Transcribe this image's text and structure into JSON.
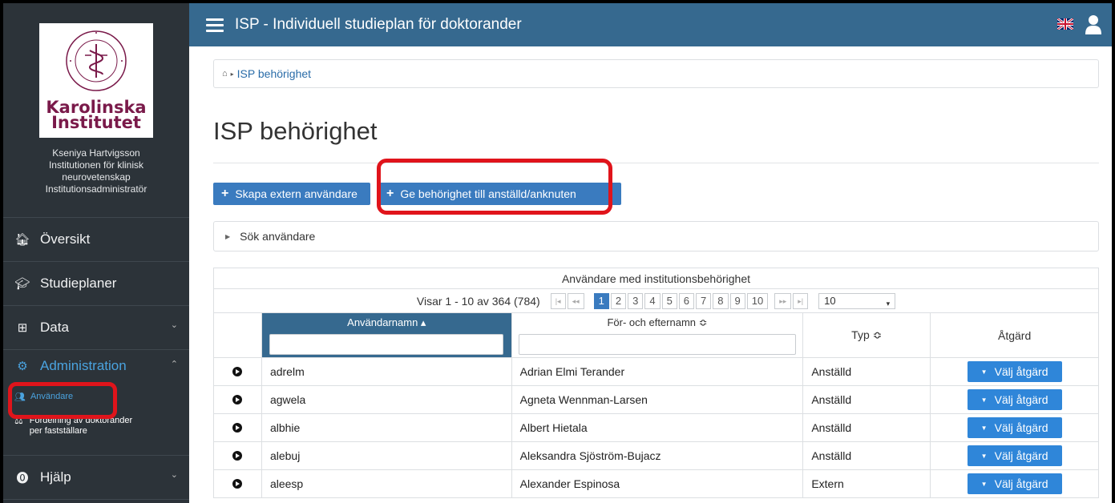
{
  "app": {
    "title": "ISP - Individuell studieplan för doktorander"
  },
  "profile": {
    "logo_line1": "Karolinska",
    "logo_line2": "Institutet",
    "name": "Kseniya Hartvigsson",
    "dept1": "Institutionen för klinisk",
    "dept2": "neurovetenskap",
    "role": "Institutionsadministratör"
  },
  "nav": {
    "oversikt": "Översikt",
    "studieplaner": "Studieplaner",
    "data": "Data",
    "administration": "Administration",
    "anvandare": "Användare",
    "fordelning1": "Fördelning av doktorander",
    "fordelning2": "per fastställare",
    "hjalp": "Hjälp"
  },
  "breadcrumb": {
    "current": "ISP behörighet"
  },
  "page": {
    "title": "ISP behörighet",
    "btn_create": "Skapa extern användare",
    "btn_grant": "Ge behörighet till anställd/anknuten",
    "search_label": "Sök användare"
  },
  "table": {
    "caption": "Användare med institutionsbehörighet",
    "pager_info": "Visar 1 - 10 av 364  (784)",
    "pages": [
      "1",
      "2",
      "3",
      "4",
      "5",
      "6",
      "7",
      "8",
      "9",
      "10"
    ],
    "page_size": "10",
    "headers": {
      "username": "Användarnamn ▴",
      "fullname": "För- och efternamn ≎",
      "type": "Typ ≎",
      "action": "Åtgärd"
    },
    "action_label": "Välj åtgärd",
    "rows": [
      {
        "username": "adrelm",
        "fullname": "Adrian Elmi Terander",
        "type": "Anställd"
      },
      {
        "username": "agwela",
        "fullname": "Agneta Wennman-Larsen",
        "type": "Anställd"
      },
      {
        "username": "albhie",
        "fullname": "Albert Hietala",
        "type": "Anställd"
      },
      {
        "username": "alebuj",
        "fullname": "Aleksandra Sjöström-Bujacz",
        "type": "Anställd"
      },
      {
        "username": "aleesp",
        "fullname": "Alexander Espinosa",
        "type": "Extern"
      }
    ]
  },
  "colors": {
    "topbar": "#36698f",
    "sidebar": "#2c3339",
    "accent": "#3a7bbf",
    "highlight": "#e0141b"
  }
}
